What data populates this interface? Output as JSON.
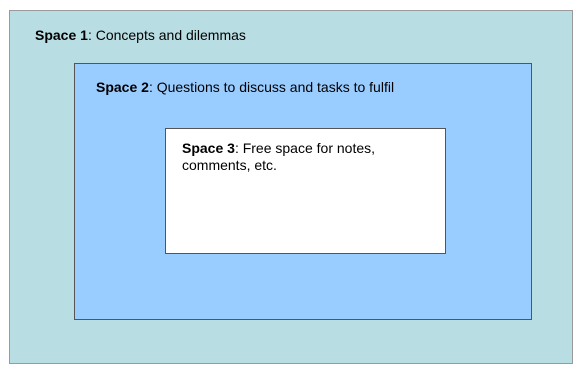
{
  "spaces": [
    {
      "name": "Space 1",
      "description": ": Concepts and dilemmas"
    },
    {
      "name": "Space 2",
      "description": ": Questions to discuss and tasks to fulfil"
    },
    {
      "name": "Space 3",
      "description": ": Free space for notes, comments, etc."
    }
  ],
  "colors": {
    "space1_fill": "#b8dde2",
    "space2_fill": "#99ccff",
    "space3_fill": "#ffffff"
  }
}
